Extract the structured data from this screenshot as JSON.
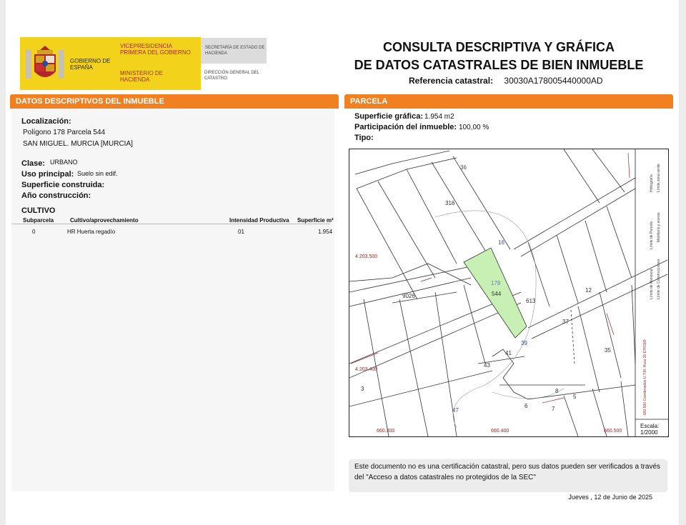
{
  "header": {
    "gobierno": "GOBIERNO DE ESPAÑA",
    "vicepresidencia": "VICEPRESIDENCIA PRIMERA DEL GOBIERNO",
    "ministerio": "MINISTERIO DE HACIENDA",
    "secretaria": "SECRETARÍA DE ESTADO DE HACIENDA",
    "direccion": "DIRECCIÓN GENERAL DEL CATASTRO",
    "title_line1": "CONSULTA DESCRIPTIVA Y GRÁFICA",
    "title_line2": "DE DATOS CATASTRALES DE BIEN INMUEBLE",
    "referencia_label": "Referencia catastral:",
    "referencia_value": "30030A178005440000AD"
  },
  "datos": {
    "section_title": "DATOS DESCRIPTIVOS DEL INMUEBLE",
    "localizacion_label": "Localización:",
    "localizacion_line1": "Polígono 178 Parcela 544",
    "localizacion_line2": "SAN MIGUEL. MURCIA [MURCIA]",
    "clase_label": "Clase:",
    "clase_value": "URBANO",
    "uso_label": "Uso principal:",
    "uso_value": "Suelo sin edif.",
    "superficie_label": "Superficie construida:",
    "anio_label": "Año construcción:"
  },
  "cultivo": {
    "title": "CULTIVO",
    "headers": [
      "Subparcela",
      "Cultivo/aprovechamiento",
      "Intensidad Productiva",
      "Superficie m²"
    ],
    "rows": [
      [
        "0",
        "HR Huerta regadío",
        "01",
        "1.954"
      ]
    ]
  },
  "parcela": {
    "section_title": "PARCELA",
    "superficie_label": "Superficie gráfica:",
    "superficie_value": "1.954 m2",
    "participacion_label": "Participación del inmueble:",
    "participacion_value": "100,00 %",
    "tipo_label": "Tipo:"
  },
  "map": {
    "labels": {
      "p316": "316",
      "p178": "178",
      "p544": "544",
      "p613": "613",
      "c9026": "9026",
      "n41": "41",
      "n43": "43",
      "n39": "39",
      "n37": "37",
      "n35": "35",
      "n8": "8",
      "n7": "7",
      "n6": "6",
      "n5": "5",
      "n3": "3",
      "n47": "47",
      "n36": "36",
      "n16": "16",
      "n12": "12",
      "y1": "4.203.500",
      "y2": "4.203.400",
      "x1": "660.300",
      "x2": "660.400",
      "x3": "660.500"
    },
    "legend": [
      "Límite de Manzana",
      "Límite de Parcela",
      "Límite de Construcciones",
      "Mobiliario y aceras",
      "Límite zona verde",
      "Hidrografía"
    ],
    "coord_note": "660.500 Coordenadas U.T.M. Huso 30 ETRS89",
    "escala_label": "Escala:",
    "escala_value": "1/2000",
    "parcel_color": "#c8f0b4"
  },
  "footer": {
    "note": "Este documento no es una certificación catastral, pero sus datos pueden ser verificados a través del \"Acceso a datos catastrales no protegidos de la SEC\"",
    "date": "Jueves , 12 de Junio de 2025"
  },
  "colors": {
    "accent": "#f08020",
    "logo_yellow": "#f2d21a",
    "ministry_red": "#b0262a"
  }
}
